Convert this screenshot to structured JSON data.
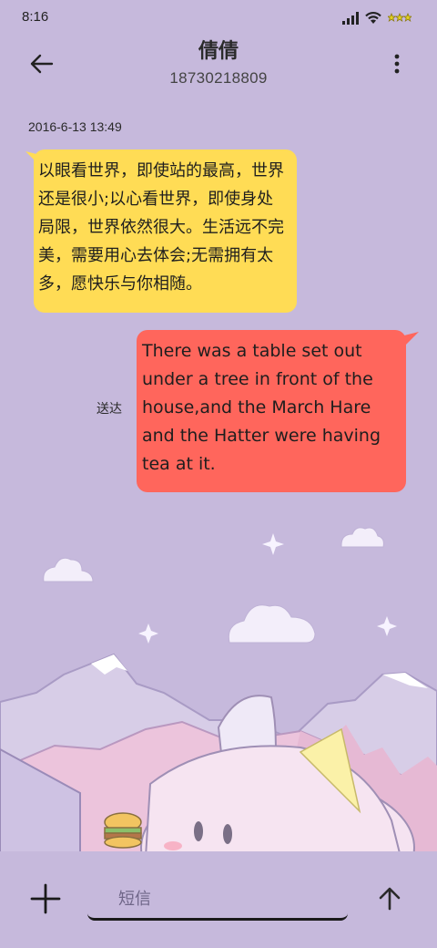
{
  "status_bar": {
    "time": "8:16",
    "icons": [
      "signal-icon",
      "wifi-icon",
      "battery-icon"
    ]
  },
  "header": {
    "back_icon": "arrow-left-icon",
    "contact_name": "倩倩",
    "contact_number": "18730218809",
    "more_icon": "more-vertical-icon"
  },
  "conversation": {
    "timestamp": "2016-6-13 13:49",
    "messages": [
      {
        "direction": "incoming",
        "text": "以眼看世界，即使站的最高，世界\n还是很小;以心看世界，即使身处\n局限，世界依然很大。生活远不完\n美，需要用心去体会;无需拥有太\n多，愿快乐与你相随。"
      },
      {
        "direction": "outgoing",
        "text": "There was a table set out under a tree in front of the house,and the March Hare and the Hatter were having tea at it.",
        "status": "送达"
      }
    ]
  },
  "composer": {
    "attach_icon": "plus-icon",
    "placeholder": "短信",
    "value": "",
    "send_icon": "arrow-up-icon"
  },
  "colors": {
    "background": "#c6b9dc",
    "incoming_bubble": "#ffdc55",
    "outgoing_bubble": "#ff665c"
  }
}
